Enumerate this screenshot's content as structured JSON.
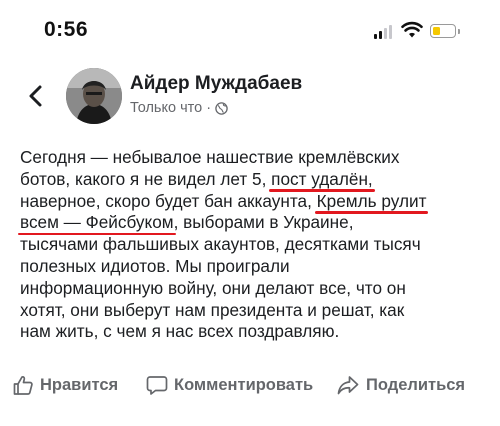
{
  "status_bar": {
    "time": "0:56"
  },
  "post": {
    "author": "Айдер Муждабаев",
    "timestamp": "Только что",
    "separator": "·",
    "privacy_icon": "globe-icon",
    "lines": [
      {
        "segments": [
          {
            "text": "Сегодня — небывалое нашествие кремлёвских"
          }
        ]
      },
      {
        "segments": [
          {
            "text": "ботов, какого я не видел лет 5, "
          },
          {
            "text": "пост удалён,",
            "highlight": true
          }
        ]
      },
      {
        "segments": [
          {
            "text": "наверное, скоро будет бан аккаунта, "
          },
          {
            "text": "Кремль рулит",
            "highlight": true
          }
        ]
      },
      {
        "segments": [
          {
            "text": "всем — Фейсбуком",
            "highlight": true
          },
          {
            "text": ", выборами в Украине,"
          }
        ]
      },
      {
        "segments": [
          {
            "text": "тысячами фальшивых акаунтов, десятками тысяч"
          }
        ]
      },
      {
        "segments": [
          {
            "text": "полезных идиотов. Мы проиграли"
          }
        ]
      },
      {
        "segments": [
          {
            "text": "информационную войну, они делают все, что он"
          }
        ]
      },
      {
        "segments": [
          {
            "text": "хотят, они выберут нам президента и решат, как"
          }
        ]
      },
      {
        "segments": [
          {
            "text": "нам жить, с чем я нас всех поздравляю."
          }
        ]
      }
    ],
    "highlight_color": "#e2181f"
  },
  "actions": {
    "like": "Нравится",
    "comment": "Комментировать",
    "share": "Поделиться"
  },
  "colors": {
    "text": "#1c1e21",
    "secondary": "#65676b",
    "battery": "#f5c800"
  }
}
